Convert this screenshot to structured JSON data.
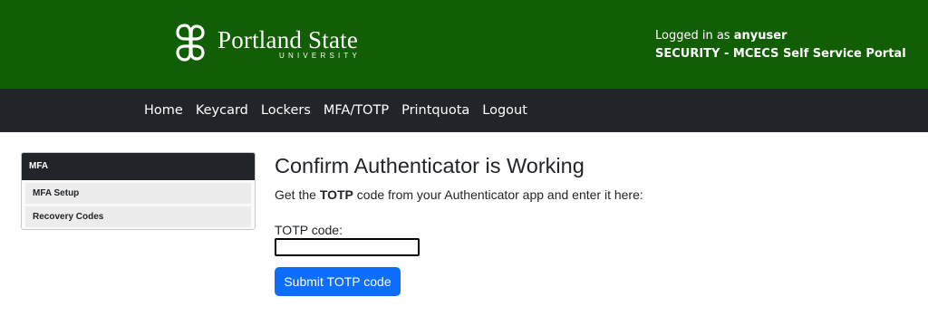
{
  "header": {
    "logo_name": "Portland State",
    "logo_sub": "UNIVERSITY",
    "login_prefix": "Logged in as",
    "username": "anyuser",
    "portal_title": "SECURITY - MCECS Self Service Portal"
  },
  "nav": {
    "items": [
      "Home",
      "Keycard",
      "Lockers",
      "MFA/TOTP",
      "Printquota",
      "Logout"
    ]
  },
  "sidebar": {
    "heading": "MFA",
    "items": [
      "MFA Setup",
      "Recovery Codes"
    ]
  },
  "main": {
    "title": "Confirm Authenticator is Working",
    "instruction_prefix": "Get the",
    "instruction_bold": "TOTP",
    "instruction_suffix": "code from your Authenticator app and enter it here:",
    "field_label": "TOTP code:",
    "field_value": "",
    "submit_label": "Submit TOTP code"
  },
  "colors": {
    "header_green": "#115e04",
    "navbar_dark": "#212529",
    "button_blue": "#0d6efd"
  }
}
